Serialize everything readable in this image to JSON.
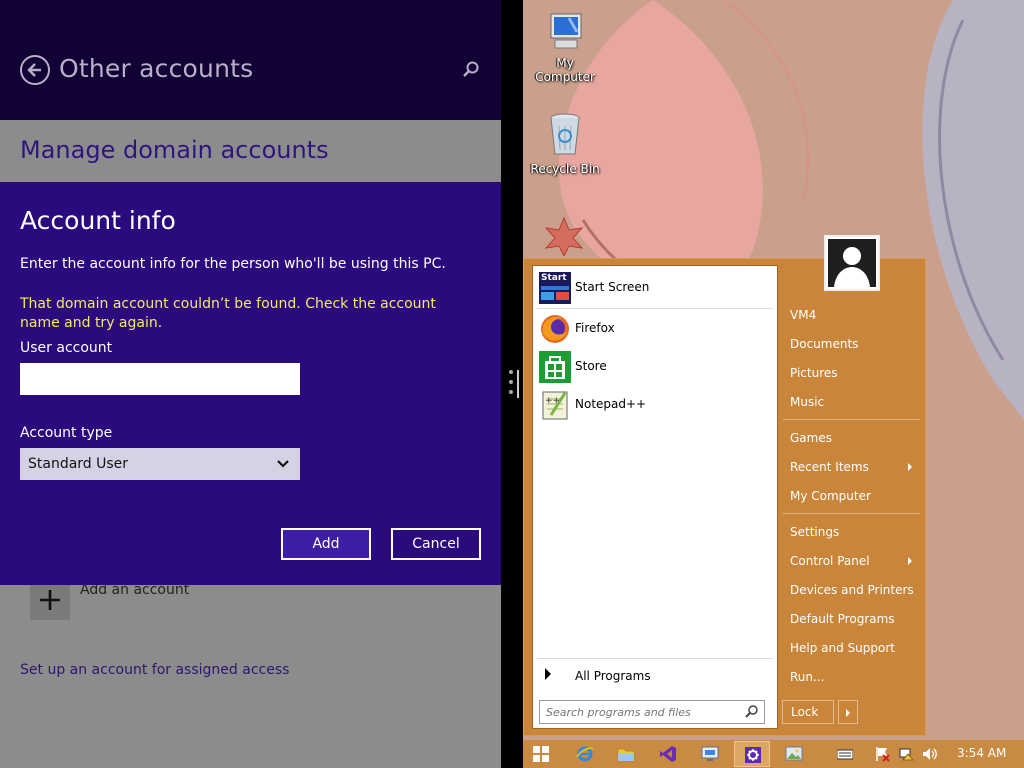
{
  "settings": {
    "header_title": "Other accounts",
    "subheader": "Manage domain accounts",
    "add_account_label": "Add an account",
    "assigned_access_link": "Set up an account for assigned access",
    "dialog": {
      "title": "Account info",
      "description": "Enter the account info for the person who'll be using this PC.",
      "error": "That domain account couldn’t be found. Check the account name and try again.",
      "user_account_label": "User account",
      "user_account_value": "",
      "account_type_label": "Account type",
      "account_type_value": "Standard User",
      "add_label": "Add",
      "cancel_label": "Cancel"
    }
  },
  "desktop": {
    "icons": [
      {
        "label": "My Computer",
        "icon": "computer-icon"
      },
      {
        "label": "Recycle Bin",
        "icon": "recycle-bin-icon"
      }
    ]
  },
  "start_menu": {
    "programs": [
      {
        "label": "Start Screen",
        "icon": "start-screen-icon"
      },
      {
        "label": "Firefox",
        "icon": "firefox-icon"
      },
      {
        "label": "Store",
        "icon": "store-icon"
      },
      {
        "label": "Notepad++",
        "icon": "notepad-plus-plus-icon"
      }
    ],
    "start_tile_text": "Start",
    "all_programs": "All Programs",
    "search_placeholder": "Search programs and files",
    "right_links": {
      "vm4": "VM4",
      "documents": "Documents",
      "pictures": "Pictures",
      "music": "Music",
      "games": "Games",
      "recent_items": "Recent Items",
      "my_computer": "My Computer",
      "settings": "Settings",
      "control_panel": "Control Panel",
      "devices_printers": "Devices and Printers",
      "default_programs": "Default Programs",
      "help_support": "Help and Support",
      "run": "Run..."
    },
    "lock_label": "Lock"
  },
  "taskbar": {
    "clock": "3:54 AM"
  },
  "colors": {
    "header_bg": "#130136",
    "dialog_bg": "#2a0a7c",
    "error_text": "#f2ea6a",
    "start_menu_bg": "#c9853a"
  }
}
